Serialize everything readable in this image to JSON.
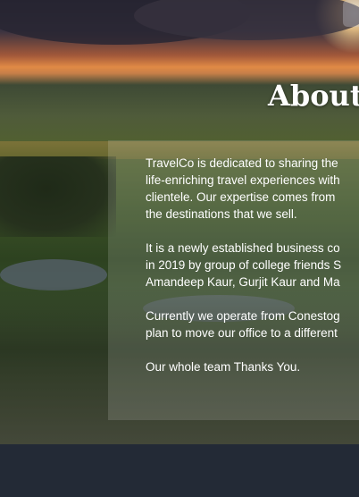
{
  "about": {
    "title": "About",
    "paragraphs": [
      [
        "TravelCo is dedicated to sharing the",
        "life-enriching travel experiences with",
        "clientele. Our expertise comes from",
        "the destinations that we sell."
      ],
      [
        "It is a newly established business co",
        "in 2019 by group of college friends S",
        "Amandeep Kaur, Gurjit Kaur and Ma"
      ],
      [
        "Currently we operate from Conestog",
        "plan to move our office to a different"
      ],
      [
        "Our  whole team Thanks You."
      ]
    ]
  },
  "colors": {
    "footer": "#232a36",
    "text": "#ffffff"
  }
}
